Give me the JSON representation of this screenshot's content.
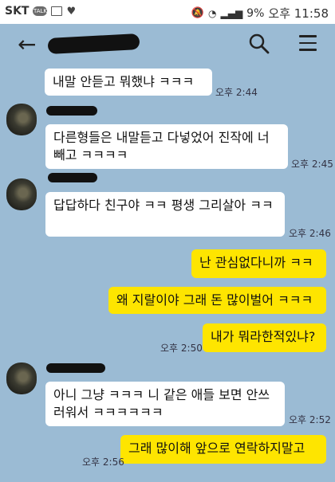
{
  "status_bar": {
    "carrier": "SKT",
    "talk_icon_text": "TALK",
    "battery": "9%",
    "time": "오후 11:58"
  },
  "header": {
    "title": ""
  },
  "messages": [
    {
      "from": "other",
      "text": "내말 안듣고 뭐했냐 ㅋㅋㅋ",
      "time": "오후 2:44"
    },
    {
      "from": "other",
      "text": "다른형들은 내말듣고 다넣었어 진작에 너 빼고 ㅋㅋㅋㅋ",
      "time": "오후 2:45"
    },
    {
      "from": "other",
      "text": "답답하다 친구야  ㅋㅋ 평생 그리살아 ㅋㅋ",
      "time": "오후 2:46"
    },
    {
      "from": "me",
      "text": "난 관심없다니까 ㅋㅋ",
      "time": ""
    },
    {
      "from": "me",
      "text": "왜 지랄이야 그래 돈 많이벌어 ㅋㅋㅋ",
      "time": ""
    },
    {
      "from": "me",
      "text": "내가 뭐라한적있냐?",
      "time": "오후 2:50"
    },
    {
      "from": "other",
      "text": "아니 그냥 ㅋㅋㅋ 니 같은 애들 보면 안쓰러워서 ㅋㅋㅋㅋㅋㅋ",
      "time": "오후 2:52"
    },
    {
      "from": "me",
      "text": "그래 많이해 앞으로 연락하지말고",
      "time": "오후 2:56"
    }
  ]
}
